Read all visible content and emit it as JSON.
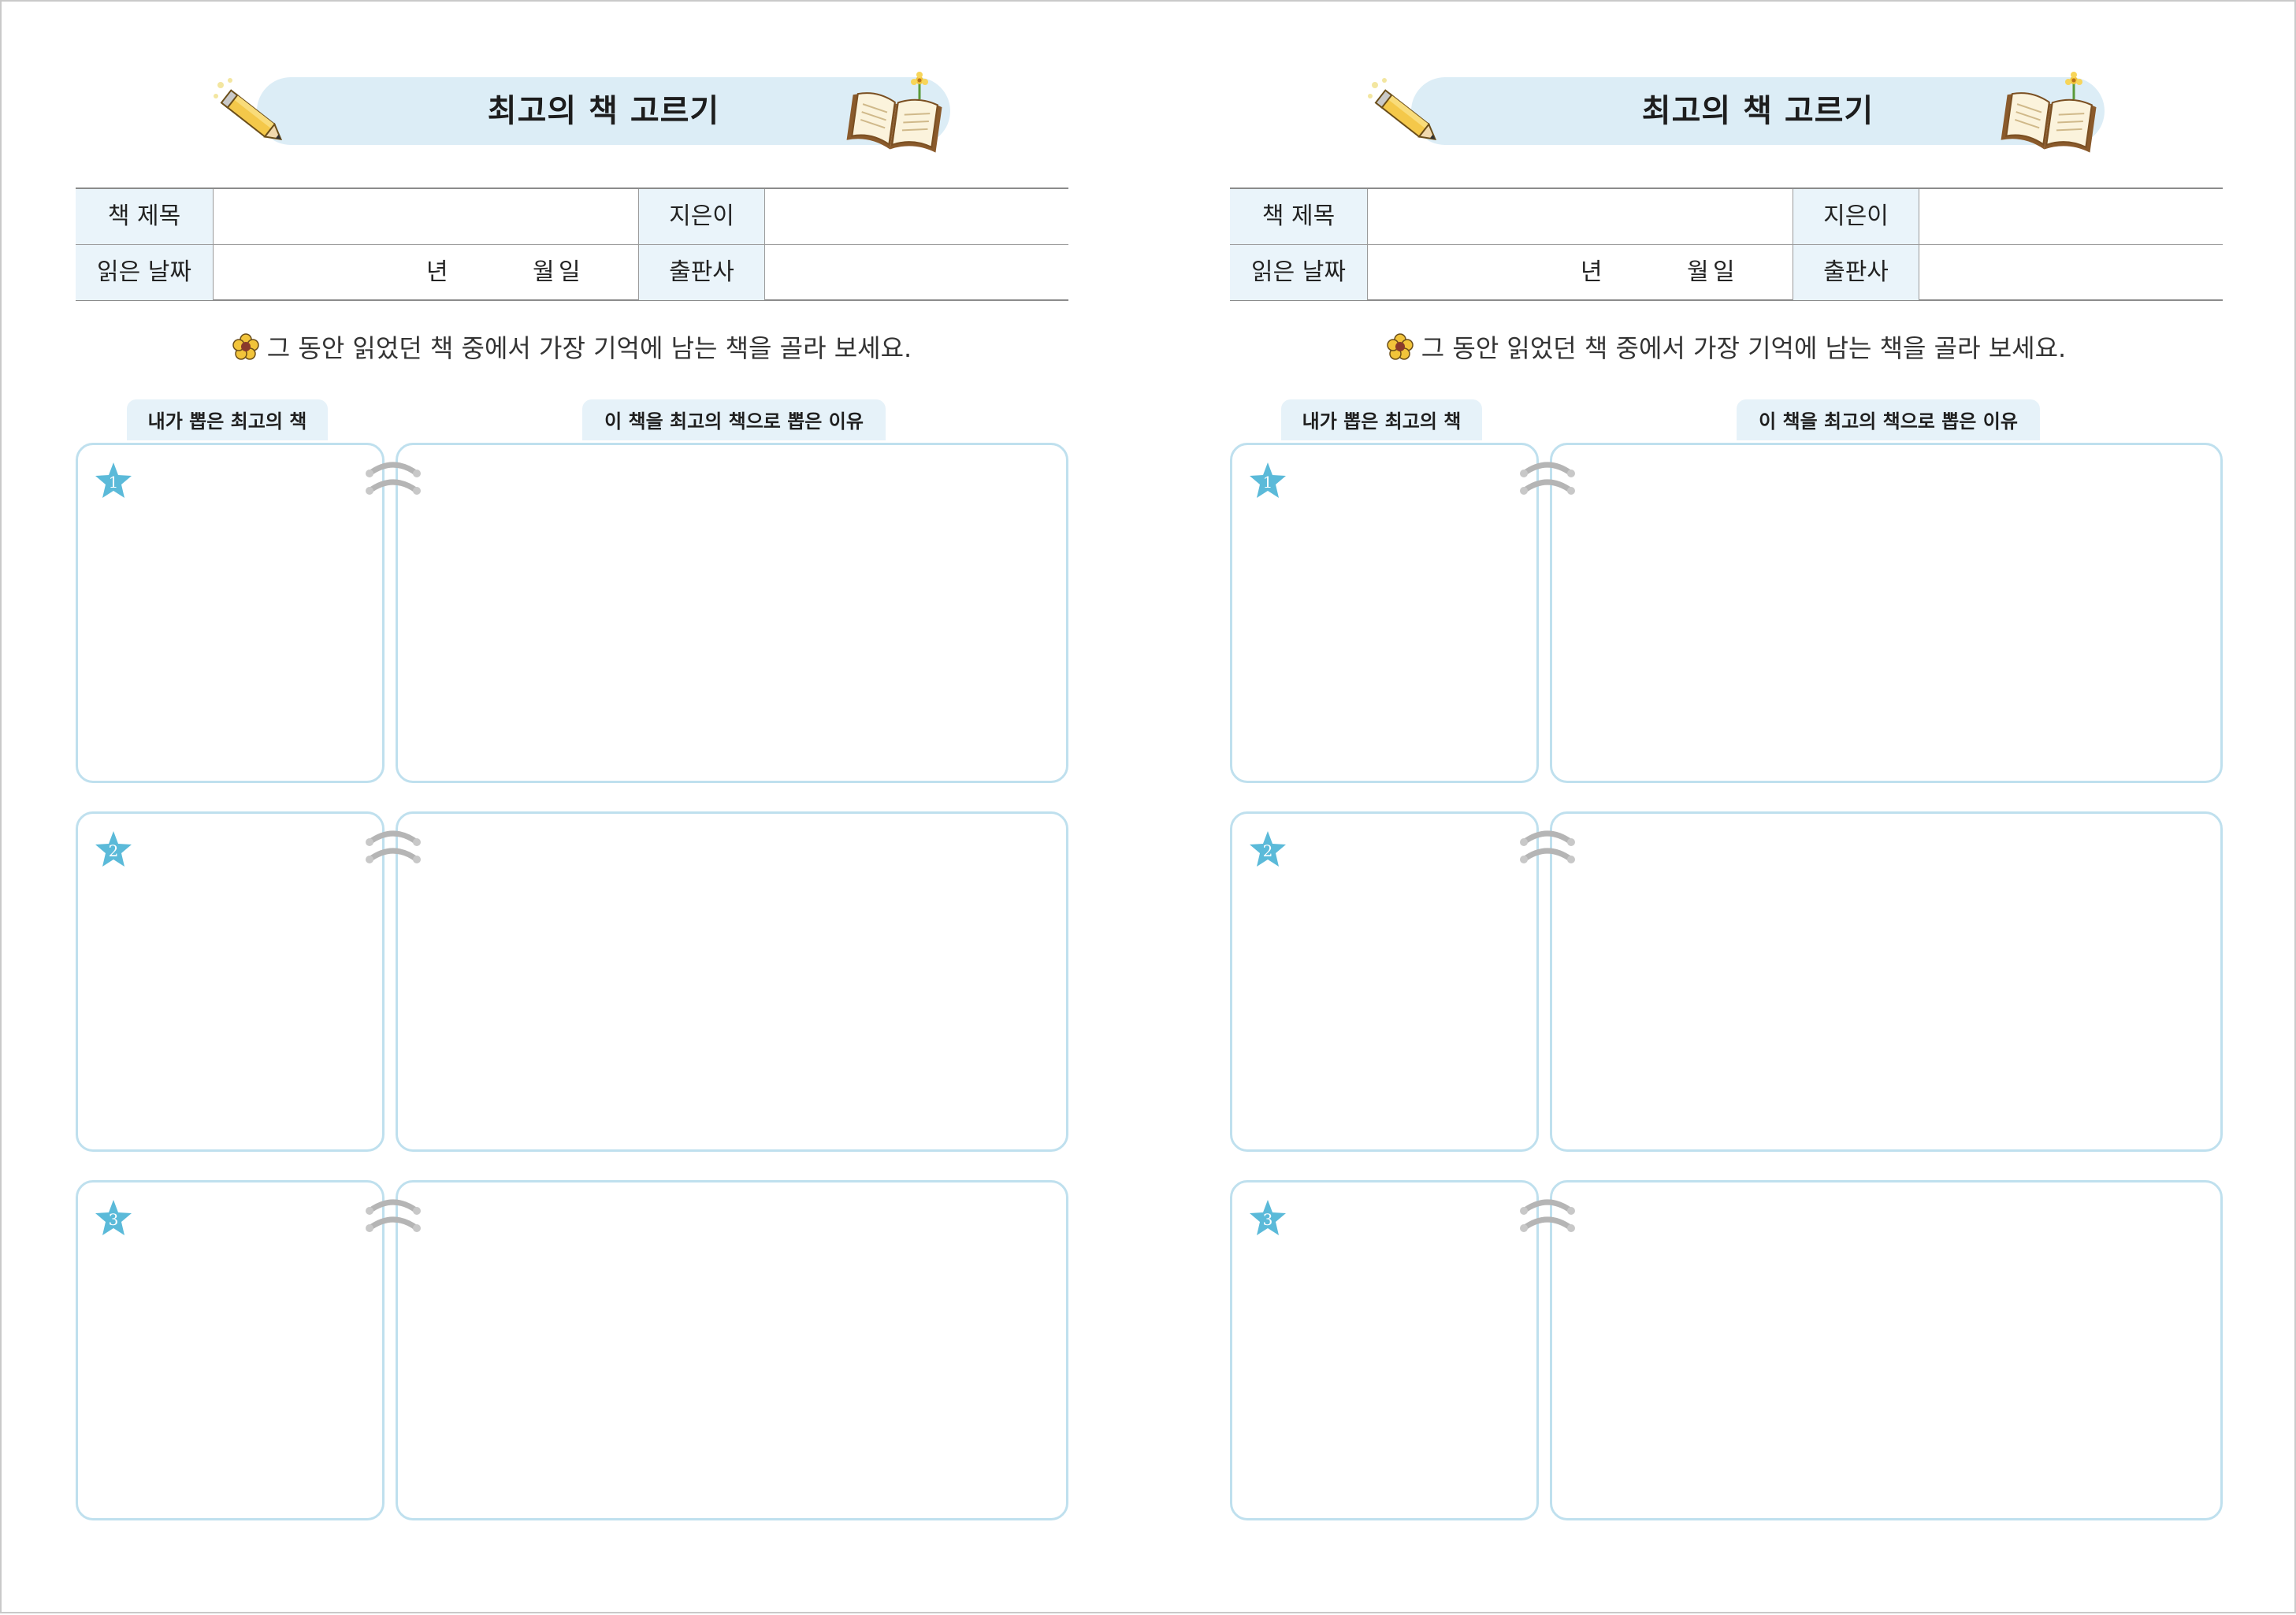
{
  "pages": [
    {
      "title": "최고의 책 고르기",
      "table": {
        "row1": {
          "label_title": "책 제목",
          "value_title": "",
          "label_author": "지은이",
          "value_author": ""
        },
        "row2": {
          "label_date": "읽은 날짜",
          "year_unit": "년",
          "month_unit": "월",
          "day_unit": "일",
          "label_publisher": "출판사",
          "value_publisher": ""
        }
      },
      "instruction": "그 동안 읽었던 책 중에서 가장 기억에 남는 책을 골라 보세요.",
      "tab_left": "내가 뽑은 최고의 책",
      "tab_right": "이 책을 최고의 책으로 뽑은 이유",
      "entries": [
        {
          "number": "1"
        },
        {
          "number": "2"
        },
        {
          "number": "3"
        }
      ]
    },
    {
      "title": "최고의 책 고르기",
      "table": {
        "row1": {
          "label_title": "책 제목",
          "value_title": "",
          "label_author": "지은이",
          "value_author": ""
        },
        "row2": {
          "label_date": "읽은 날짜",
          "year_unit": "년",
          "month_unit": "월",
          "day_unit": "일",
          "label_publisher": "출판사",
          "value_publisher": ""
        }
      },
      "instruction": "그 동안 읽었던 책 중에서 가장 기억에 남는 책을 골라 보세요.",
      "tab_left": "내가 뽑은 최고의 책",
      "tab_right": "이 책을 최고의 책으로 뽑은 이유",
      "entries": [
        {
          "number": "1"
        },
        {
          "number": "2"
        },
        {
          "number": "3"
        }
      ]
    }
  ],
  "colors": {
    "banner": "#dcedf6",
    "table_header_bg": "#eaf4fa",
    "box_border": "#bfe0ee",
    "star": "#5bbad9",
    "ring": "#b5b5b5"
  },
  "icons": [
    "pencil-icon",
    "open-book-icon",
    "flower-icon",
    "star-badge-icon",
    "binder-ring-icon"
  ]
}
